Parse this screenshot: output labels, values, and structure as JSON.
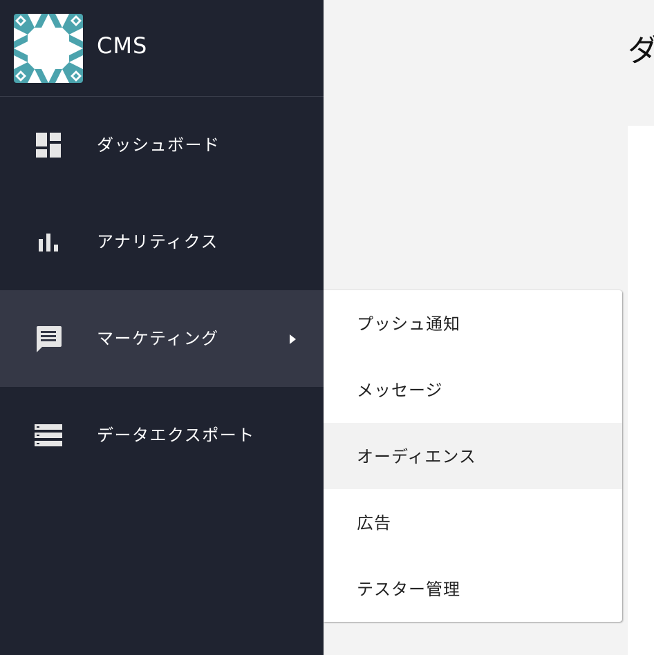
{
  "app": {
    "title": "CMS",
    "logo_icon": "geometric-tile-logo",
    "colors": {
      "sidebar_bg": "#1f2330",
      "sidebar_active": "#353846",
      "logo_teal": "#4ba3ad"
    }
  },
  "sidebar": {
    "items": [
      {
        "label": "ダッシュボード",
        "icon": "dashboard-icon"
      },
      {
        "label": "アナリティクス",
        "icon": "bar-chart-icon"
      },
      {
        "label": "マーケティング",
        "icon": "chat-message-icon",
        "active": true,
        "has_submenu": true
      },
      {
        "label": "データエクスポート",
        "icon": "storage-list-icon"
      }
    ]
  },
  "main": {
    "title": "ダ"
  },
  "submenu": {
    "items": [
      {
        "label": "プッシュ通知"
      },
      {
        "label": "メッセージ"
      },
      {
        "label": "オーディエンス",
        "hovered": true
      },
      {
        "label": "広告"
      },
      {
        "label": "テスター管理"
      }
    ]
  }
}
